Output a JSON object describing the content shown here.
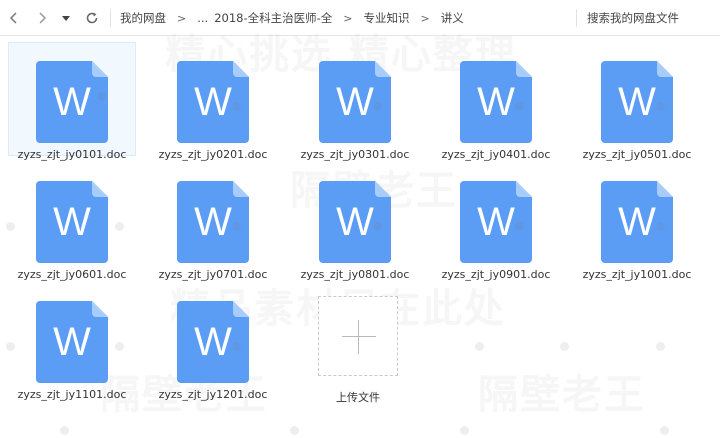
{
  "toolbar": {
    "breadcrumbs": [
      "我的网盘",
      "...",
      "2018-全科主治医师-全",
      "专业知识",
      "讲义"
    ],
    "search_label": "搜索我的网盘文件"
  },
  "files": [
    {
      "name": "zyzs_zjt_jy0101.doc",
      "icon": "word-doc-icon",
      "selected": true
    },
    {
      "name": "zyzs_zjt_jy0201.doc",
      "icon": "word-doc-icon"
    },
    {
      "name": "zyzs_zjt_jy0301.doc",
      "icon": "word-doc-icon"
    },
    {
      "name": "zyzs_zjt_jy0401.doc",
      "icon": "word-doc-icon"
    },
    {
      "name": "zyzs_zjt_jy0501.doc",
      "icon": "word-doc-icon"
    },
    {
      "name": "zyzs_zjt_jy0601.doc",
      "icon": "word-doc-icon"
    },
    {
      "name": "zyzs_zjt_jy0701.doc",
      "icon": "word-doc-icon"
    },
    {
      "name": "zyzs_zjt_jy0801.doc",
      "icon": "word-doc-icon"
    },
    {
      "name": "zyzs_zjt_jy0901.doc",
      "icon": "word-doc-icon"
    },
    {
      "name": "zyzs_zjt_jy1001.doc",
      "icon": "word-doc-icon"
    },
    {
      "name": "zyzs_zjt_jy1101.doc",
      "icon": "word-doc-icon"
    },
    {
      "name": "zyzs_zjt_jy1201.doc",
      "icon": "word-doc-icon"
    }
  ],
  "upload": {
    "label": "上传文件",
    "icon": "plus-icon"
  },
  "icon_letter": "W",
  "watermarks": [
    "精心挑选  精心整理",
    "隔壁老王",
    "精品素材尽在此处",
    "隔壁老王",
    "隔壁老王"
  ],
  "colors": {
    "doc_blue": "#5b9cf5",
    "doc_fold": "#a9cdfb",
    "selected_bg": "#f1f8fe"
  }
}
